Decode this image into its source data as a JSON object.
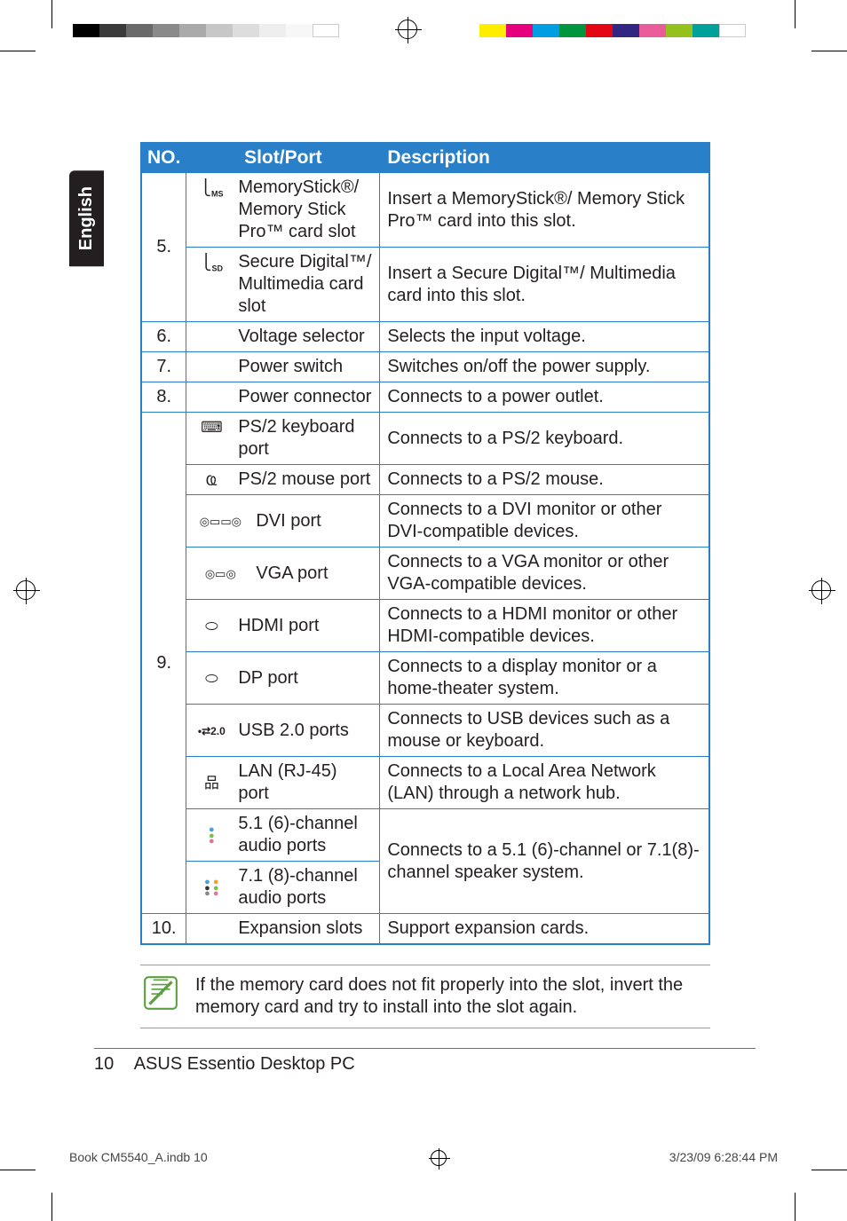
{
  "language_tab": "English",
  "table": {
    "headers": {
      "no": "NO.",
      "slot": "Slot/Port",
      "desc": "Description"
    },
    "rows": [
      {
        "no": "5.",
        "sub": [
          {
            "icon": "MS",
            "slot": "MemoryStick®/ Memory Stick Pro™ card slot",
            "desc": "Insert a MemoryStick®/ Memory Stick Pro™ card into this slot."
          },
          {
            "icon": "SD",
            "slot": "Secure Digital™/ Multimedia card slot",
            "desc": "Insert a Secure Digital™/ Multimedia card into this slot."
          }
        ]
      },
      {
        "no": "6.",
        "slot": "Voltage selector",
        "desc": "Selects the input voltage."
      },
      {
        "no": "7.",
        "slot": "Power switch",
        "desc": "Switches on/off the power supply."
      },
      {
        "no": "8.",
        "slot": "Power connector",
        "desc": "Connects to a power outlet."
      },
      {
        "no": "9.",
        "sub": [
          {
            "icon": "⌨",
            "slot": "PS/2 keyboard port",
            "desc": "Connects to a PS/2 keyboard."
          },
          {
            "icon": "🖱",
            "slot": "PS/2 mouse port",
            "desc": "Connects to a PS/2 mouse."
          },
          {
            "icon": "▭▭",
            "slot": "DVI port",
            "desc": "Connects to a DVI monitor or other DVI-compatible devices."
          },
          {
            "icon": "▭",
            "slot": "VGA port",
            "desc": "Connects to a VGA monitor or other VGA-compatible devices."
          },
          {
            "icon": "⬭",
            "slot": "HDMI port",
            "desc": "Connects to a HDMI monitor or other HDMI-compatible devices."
          },
          {
            "icon": "⬭",
            "slot": "DP port",
            "desc": "Connects to a display monitor or a home-theater system."
          },
          {
            "icon": "•⇄2.0",
            "slot": "USB 2.0 ports",
            "desc": "Connects to USB devices such as a mouse or keyboard."
          },
          {
            "icon": "品",
            "slot": "LAN (RJ-45) port",
            "desc": "Connects to a Local Area Network (LAN) through a network hub."
          },
          {
            "icon": "●●●",
            "slot": "5.1 (6)-channel audio ports",
            "desc": "Connects to a 5.1 (6)-channel or 7.1(8)-channel speaker system.",
            "audio_group": true
          },
          {
            "icon": "●●●●●●",
            "slot": "7.1 (8)-channel audio ports",
            "audio_group": true
          }
        ]
      },
      {
        "no": "10.",
        "slot": "Expansion slots",
        "desc": "Support expansion cards."
      }
    ]
  },
  "note": "If the memory card does not fit properly into the slot, invert the memory card and try to install into the slot again.",
  "footer": {
    "page_number": "10",
    "title": "ASUS Essentio Desktop PC"
  },
  "imprint": {
    "left": "Book CM5540_A.indb   10",
    "right": "3/23/09   6:28:44 PM"
  }
}
